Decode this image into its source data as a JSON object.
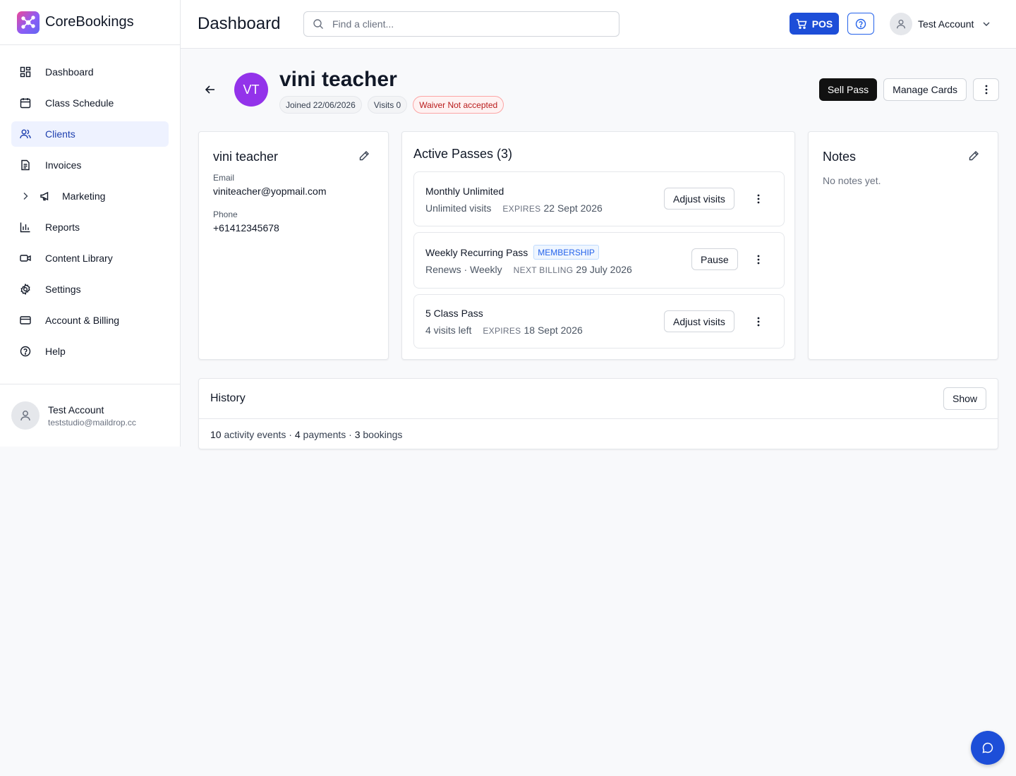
{
  "brand": {
    "name": "CoreBookings"
  },
  "sidebar": {
    "items": [
      {
        "label": "Dashboard",
        "icon": "dashboard-icon"
      },
      {
        "label": "Class Schedule",
        "icon": "calendar-icon"
      },
      {
        "label": "Clients",
        "icon": "users-icon",
        "active": true
      },
      {
        "label": "Invoices",
        "icon": "document-icon"
      },
      {
        "label": "Marketing",
        "icon": "megaphone-icon"
      },
      {
        "label": "Reports",
        "icon": "bar-chart-icon"
      },
      {
        "label": "Content Library",
        "icon": "video-icon"
      },
      {
        "label": "Settings",
        "icon": "gear-icon"
      },
      {
        "label": "Account & Billing",
        "icon": "credit-card-icon"
      },
      {
        "label": "Help",
        "icon": "help-circle-icon"
      }
    ],
    "user": {
      "name": "Test Account",
      "email": "teststudio@maildrop.cc"
    }
  },
  "header": {
    "title": "Dashboard",
    "search_placeholder": "Find a client...",
    "pos_label": "POS",
    "account_name": "Test Account"
  },
  "client": {
    "initials": "VT",
    "name": "vini teacher",
    "joined": "Joined 22/06/2026",
    "visits": "Visits 0",
    "waiver": "Waiver Not accepted",
    "actions": {
      "sell_pass": "Sell Pass",
      "manage_cards": "Manage Cards"
    }
  },
  "info_card": {
    "name": "vini teacher",
    "email_label": "Email",
    "email": "viniteacher@yopmail.com",
    "phone_label": "Phone",
    "phone": "+61412345678"
  },
  "passes": {
    "title": "Active Passes (3)",
    "items": [
      {
        "name": "Monthly Unlimited",
        "tag": "",
        "detail": "Unlimited visits",
        "key": "EXPIRES",
        "date": "22 Sept 2026",
        "action": "Adjust visits"
      },
      {
        "name": "Weekly Recurring Pass",
        "tag": "MEMBERSHIP",
        "detail": "Renews · Weekly",
        "key": "NEXT BILLING",
        "date": "29 July 2026",
        "action": "Pause"
      },
      {
        "name": "5 Class Pass",
        "tag": "",
        "detail": "4 visits left",
        "key": "EXPIRES",
        "date": "18 Sept 2026",
        "action": "Adjust visits"
      }
    ]
  },
  "notes": {
    "title": "Notes",
    "empty": "No notes yet."
  },
  "history": {
    "title": "History",
    "show_label": "Show",
    "activity_count": "10",
    "activity_label": "activity events",
    "payments_count": "4",
    "payments_label": "payments",
    "bookings_count": "3",
    "bookings_label": "bookings"
  },
  "colors": {
    "primary": "#1d4ed8",
    "avatar": "#9333ea",
    "warning": "#b91c1c"
  }
}
